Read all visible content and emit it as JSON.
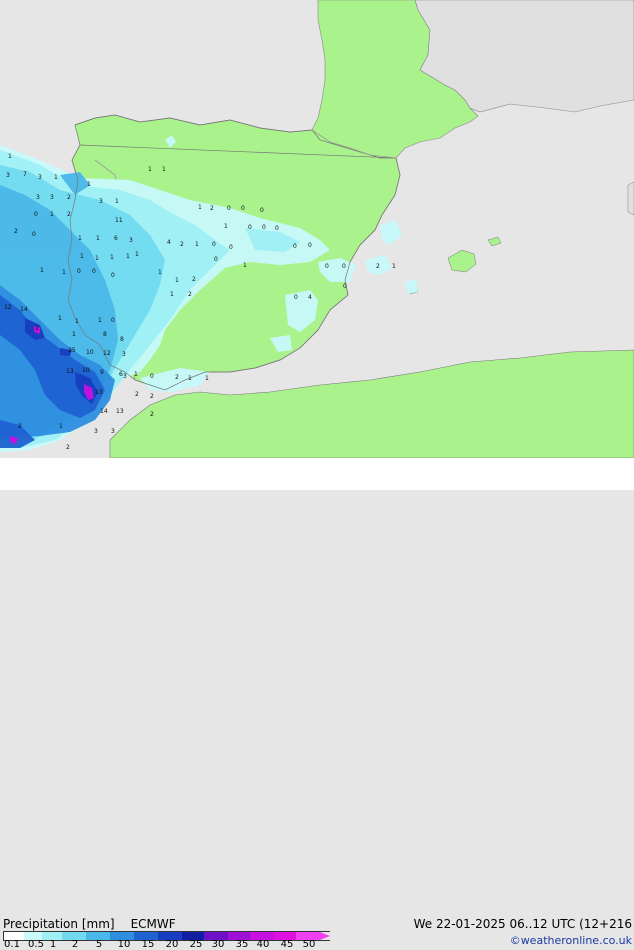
{
  "map": {
    "labels": [
      {
        "t": "1"
      },
      {
        "t": "3"
      },
      {
        "t": "7"
      },
      {
        "t": "3"
      },
      {
        "t": "1"
      },
      {
        "t": "3"
      },
      {
        "t": "3"
      },
      {
        "t": "2"
      },
      {
        "t": "1"
      },
      {
        "t": "3"
      },
      {
        "t": "1"
      },
      {
        "t": "0"
      },
      {
        "t": "1"
      },
      {
        "t": "2"
      },
      {
        "t": "11"
      },
      {
        "t": "2"
      },
      {
        "t": "0"
      },
      {
        "t": "1"
      },
      {
        "t": "1"
      },
      {
        "t": "6"
      },
      {
        "t": "3"
      },
      {
        "t": "1"
      },
      {
        "t": "1"
      },
      {
        "t": "1"
      },
      {
        "t": "1"
      },
      {
        "t": "1"
      },
      {
        "t": "4"
      },
      {
        "t": "2"
      },
      {
        "t": "1"
      },
      {
        "t": "0"
      },
      {
        "t": "1"
      },
      {
        "t": "1"
      },
      {
        "t": "0"
      },
      {
        "t": "0"
      },
      {
        "t": "0"
      },
      {
        "t": "1"
      },
      {
        "t": "1"
      },
      {
        "t": "2"
      },
      {
        "t": "2"
      },
      {
        "t": "1"
      },
      {
        "t": "12"
      },
      {
        "t": "14"
      },
      {
        "t": "1"
      },
      {
        "t": "1"
      },
      {
        "t": "1"
      },
      {
        "t": "0"
      },
      {
        "t": "1"
      },
      {
        "t": "1"
      },
      {
        "t": "8"
      },
      {
        "t": "8"
      },
      {
        "t": "25"
      },
      {
        "t": "10"
      },
      {
        "t": "12"
      },
      {
        "t": "3"
      },
      {
        "t": "13"
      },
      {
        "t": "10"
      },
      {
        "t": "9"
      },
      {
        "t": "6"
      },
      {
        "t": "1"
      },
      {
        "t": "13"
      },
      {
        "t": "2"
      },
      {
        "t": "2"
      },
      {
        "t": "2"
      },
      {
        "t": "14"
      },
      {
        "t": "13"
      },
      {
        "t": "2"
      },
      {
        "t": "2"
      },
      {
        "t": "1"
      },
      {
        "t": "3"
      },
      {
        "t": "3"
      },
      {
        "t": "3"
      },
      {
        "t": "0"
      },
      {
        "t": "2"
      },
      {
        "t": "1"
      },
      {
        "t": "1"
      },
      {
        "t": "1"
      },
      {
        "t": "1"
      },
      {
        "t": "1"
      },
      {
        "t": "2"
      },
      {
        "t": "0"
      },
      {
        "t": "0"
      },
      {
        "t": "0"
      },
      {
        "t": "1"
      },
      {
        "t": "0"
      },
      {
        "t": "0"
      },
      {
        "t": "0"
      },
      {
        "t": "0"
      },
      {
        "t": "0"
      },
      {
        "t": "0"
      },
      {
        "t": "0"
      },
      {
        "t": "1"
      },
      {
        "t": "0"
      },
      {
        "t": "0"
      },
      {
        "t": "0"
      },
      {
        "t": "2"
      },
      {
        "t": "1"
      },
      {
        "t": "4"
      },
      {
        "t": "0"
      }
    ]
  },
  "legend": {
    "title": "Precipitation [mm]",
    "model": "ECMWF",
    "datetime": "We 22-01-2025 06..12 UTC (12+216",
    "credit": "©weatheronline.co.uk",
    "scale": [
      {
        "label": "0.1",
        "color": "#ffffff"
      },
      {
        "label": "0.5",
        "color": "#c8fafc"
      },
      {
        "label": "1",
        "color": "#9ef0f6"
      },
      {
        "label": "2",
        "color": "#72daf0"
      },
      {
        "label": "5",
        "color": "#4ab8e8"
      },
      {
        "label": "10",
        "color": "#2e8ee0"
      },
      {
        "label": "15",
        "color": "#1f62d2"
      },
      {
        "label": "20",
        "color": "#173ec0"
      },
      {
        "label": "25",
        "color": "#1020a0"
      },
      {
        "label": "30",
        "color": "#7010c8"
      },
      {
        "label": "35",
        "color": "#a010d8"
      },
      {
        "label": "40",
        "color": "#c810e0"
      },
      {
        "label": "45",
        "color": "#e010e0"
      },
      {
        "label": "50",
        "color": "#f040f0"
      }
    ]
  },
  "colors": {
    "sea": "#e6e6e6",
    "land": "#aaf28c",
    "border": "#999999",
    "coast": "#7a7a7a"
  }
}
